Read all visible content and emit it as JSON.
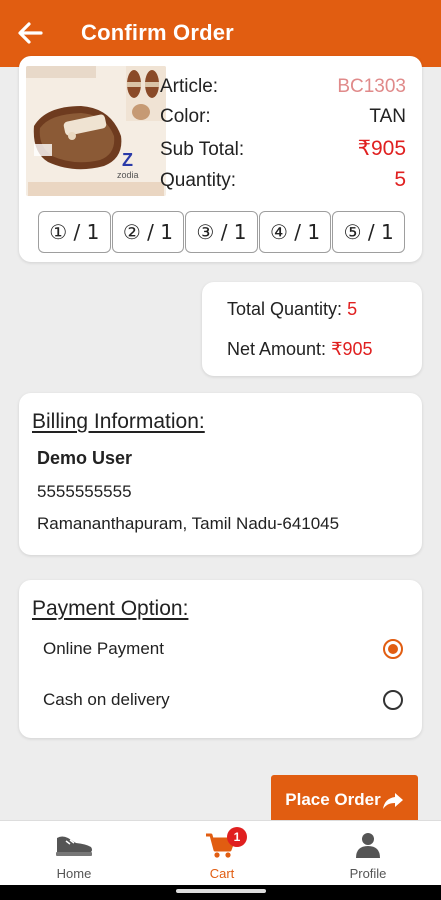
{
  "header": {
    "title": "Confirm Order",
    "back_icon": "arrow-left-icon"
  },
  "product": {
    "brand_letter": "Z",
    "brand_name": "zodia",
    "article_label": "Article:",
    "article_value": "BC1303",
    "color_label": "Color:",
    "color_value": "TAN",
    "subtotal_label": "Sub Total:",
    "subtotal_value": "₹905",
    "quantity_label": "Quantity:",
    "quantity_value": "5",
    "sizes": [
      "① / 1",
      "② / 1",
      "③ / 1",
      "④ / 1",
      "⑤ / 1"
    ]
  },
  "totals": {
    "quantity_label": "Total Quantity:",
    "quantity_value": "5",
    "amount_label": "Net Amount:",
    "amount_value": "₹905"
  },
  "billing": {
    "title": "Billing Information:",
    "name": "Demo User",
    "phone": "5555555555",
    "address": "Ramananthapuram,  Tamil Nadu-641045"
  },
  "payment": {
    "title": "Payment Option:",
    "options": [
      {
        "label": "Online Payment",
        "selected": true
      },
      {
        "label": "Cash on delivery",
        "selected": false
      }
    ]
  },
  "place_order_label": "Place Order",
  "nav": {
    "home_label": "Home",
    "cart_label": "Cart",
    "cart_badge": "1",
    "profile_label": "Profile"
  },
  "colors": {
    "accent": "#e15d11",
    "price_red": "#e02020",
    "article_pink": "#e08a8a",
    "background": "#ededed"
  }
}
